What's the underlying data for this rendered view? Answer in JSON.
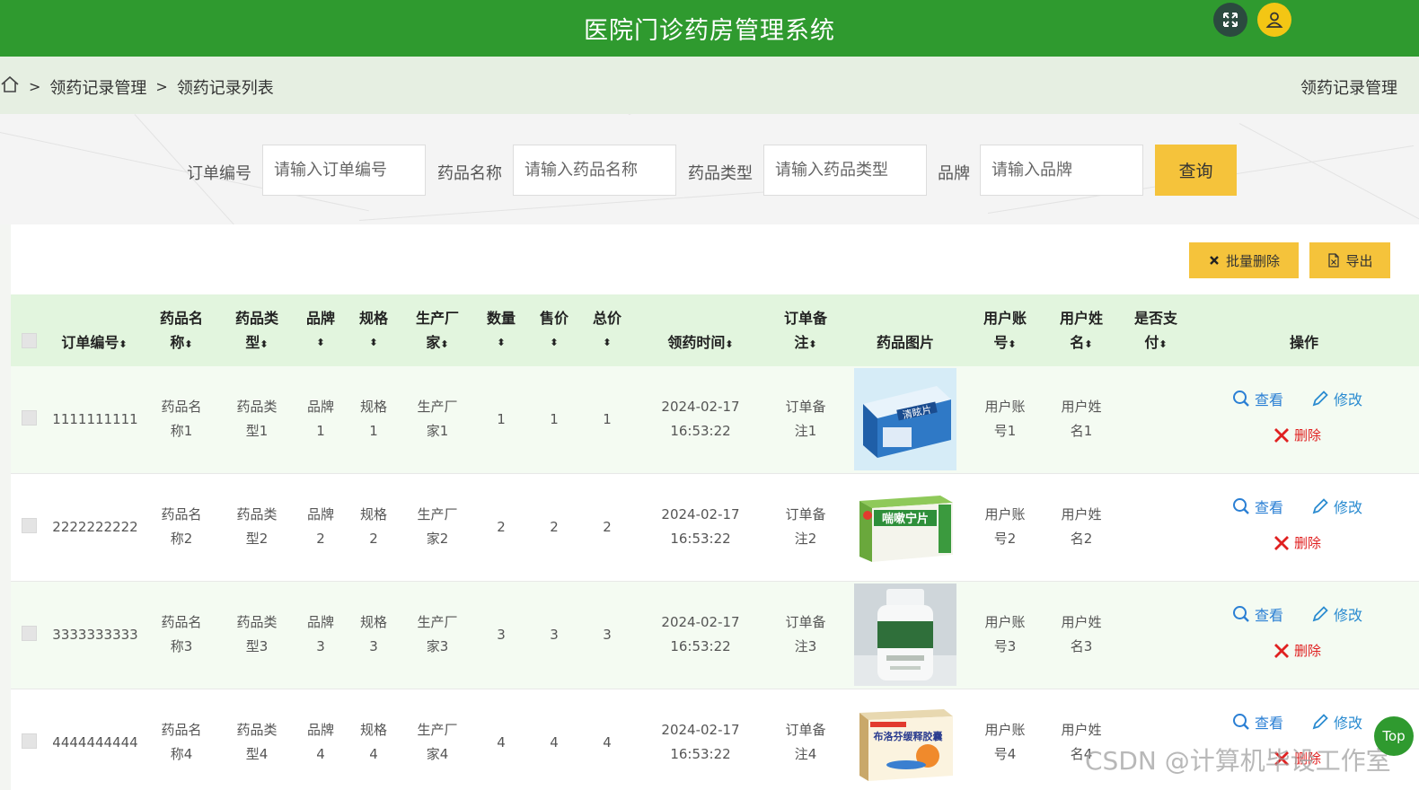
{
  "header": {
    "app_title": "医院门诊药房管理系统",
    "expand_icon": "expand-icon",
    "user_icon": "user-icon"
  },
  "breadcrumb": {
    "home_icon": "home-icon",
    "separator": ">",
    "items": [
      "领药记录管理",
      "领药记录列表"
    ],
    "right_title": "领药记录管理"
  },
  "search": {
    "fields": [
      {
        "label": "订单编号",
        "placeholder": "请输入订单编号"
      },
      {
        "label": "药品名称",
        "placeholder": "请输入药品名称"
      },
      {
        "label": "药品类型",
        "placeholder": "请输入药品类型"
      },
      {
        "label": "品牌",
        "placeholder": "请输入品牌"
      }
    ],
    "button_label": "查询"
  },
  "toolbar": {
    "batch_delete_label": "批量删除",
    "export_label": "导出"
  },
  "table": {
    "headers": {
      "order_no": "订单编号",
      "drug_name_1": "药品名",
      "drug_name_2": "称",
      "drug_type_1": "药品类",
      "drug_type_2": "型",
      "brand": "品牌",
      "spec": "规格",
      "maker_1": "生产厂",
      "maker_2": "家",
      "qty": "数量",
      "price": "售价",
      "total": "总价",
      "time": "领药时间",
      "remark_1": "订单备",
      "remark_2": "注",
      "image": "药品图片",
      "account_1": "用户账",
      "account_2": "号",
      "username_1": "用户姓",
      "username_2": "名",
      "paid_1": "是否支",
      "paid_2": "付",
      "ops": "操作",
      "sort_mark": "⬍"
    },
    "rows": [
      {
        "order_no": "1111111111",
        "name_1": "药品名",
        "name_2": "称1",
        "type_1": "药品类",
        "type_2": "型1",
        "brand_1": "品牌",
        "brand_2": "1",
        "spec_1": "规格",
        "spec_2": "1",
        "maker_1": "生产厂",
        "maker_2": "家1",
        "qty": "1",
        "price": "1",
        "total": "1",
        "date": "2024-02-17",
        "time": "16:53:22",
        "remark_1": "订单备",
        "remark_2": "注1",
        "account_1": "用户账",
        "account_2": "号1",
        "username_1": "用户姓",
        "username_2": "名1",
        "paid": ""
      },
      {
        "order_no": "2222222222",
        "name_1": "药品名",
        "name_2": "称2",
        "type_1": "药品类",
        "type_2": "型2",
        "brand_1": "品牌",
        "brand_2": "2",
        "spec_1": "规格",
        "spec_2": "2",
        "maker_1": "生产厂",
        "maker_2": "家2",
        "qty": "2",
        "price": "2",
        "total": "2",
        "date": "2024-02-17",
        "time": "16:53:22",
        "remark_1": "订单备",
        "remark_2": "注2",
        "account_1": "用户账",
        "account_2": "号2",
        "username_1": "用户姓",
        "username_2": "名2",
        "paid": ""
      },
      {
        "order_no": "3333333333",
        "name_1": "药品名",
        "name_2": "称3",
        "type_1": "药品类",
        "type_2": "型3",
        "brand_1": "品牌",
        "brand_2": "3",
        "spec_1": "规格",
        "spec_2": "3",
        "maker_1": "生产厂",
        "maker_2": "家3",
        "qty": "3",
        "price": "3",
        "total": "3",
        "date": "2024-02-17",
        "time": "16:53:22",
        "remark_1": "订单备",
        "remark_2": "注3",
        "account_1": "用户账",
        "account_2": "号3",
        "username_1": "用户姓",
        "username_2": "名3",
        "paid": ""
      },
      {
        "order_no": "4444444444",
        "name_1": "药品名",
        "name_2": "称4",
        "type_1": "药品类",
        "type_2": "型4",
        "brand_1": "品牌",
        "brand_2": "4",
        "spec_1": "规格",
        "spec_2": "4",
        "maker_1": "生产厂",
        "maker_2": "家4",
        "qty": "4",
        "price": "4",
        "total": "4",
        "date": "2024-02-17",
        "time": "16:53:22",
        "remark_1": "订单备",
        "remark_2": "注4",
        "account_1": "用户账",
        "account_2": "号4",
        "username_1": "用户姓",
        "username_2": "名4",
        "paid": ""
      }
    ],
    "actions": {
      "view": "查看",
      "edit": "修改",
      "delete": "删除"
    },
    "image_labels": [
      "清眩片",
      "喘嗽宁片",
      "",
      "布洛芬缓释胶囊"
    ]
  },
  "overlay": {
    "watermark": "CSDN @计算机毕设工作室",
    "top_button": "Top"
  },
  "colors": {
    "header_green": "#2f9a2f",
    "accent_yellow": "#f5c33b",
    "breadcrumb_bg": "#e6efe2",
    "table_head_bg": "#e2f5de",
    "view_blue": "#2a7fd4",
    "delete_red": "#e02020"
  }
}
